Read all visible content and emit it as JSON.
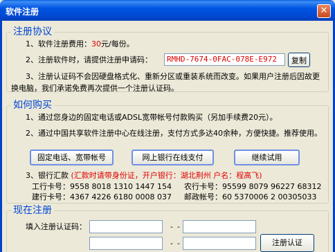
{
  "window": {
    "title": "软件注册",
    "close": "✕"
  },
  "agreement": {
    "legend": "注册协议",
    "fee_pre": "1、软件注册费用：",
    "fee_value": "30",
    "fee_post": "元/每份。",
    "code_label": "2、注册软件时，请提供注册申请码：",
    "code_value": "RMHD-7674-0FAC-078E-E972",
    "copy_button": "复制",
    "item3": "3、注册认证码不会因硬盘格式化、重新分区或重装系统而改变。如果用户注册后因故更换电脑，我们承诺免费再次提供一个注册认证码。"
  },
  "purchase": {
    "legend": "如何购买",
    "item1": "1、通过您身边的固定电话或ADSL宽带帐号付款购买（另加手续费20元）。",
    "item2": "2、通过中国共享软件注册中心在线注册，支付方式多达40余种，方便快捷。推荐使用。",
    "btn_phone": "固定电话、宽带帐号",
    "btn_online": "网上银行在线支付",
    "btn_trial": "继续试用",
    "bank_label": "3、银行汇款",
    "bank_note": "(汇款时请带身份证，开户银行：湖北荆州  户名：程高飞)",
    "accounts": [
      {
        "name": "工行卡号：",
        "number": "9558 8018 1310 1447 154"
      },
      {
        "name": "农行卡号：",
        "number": "95599 8079 96227 68312"
      },
      {
        "name": "建行卡号：",
        "number": "4367 4226 6180 0008 037"
      },
      {
        "name": "邮政帐号：",
        "number": "60 5370006 2 00305033"
      }
    ]
  },
  "register": {
    "legend": "现在注册",
    "input_label": "填入注册认证码：",
    "dash": "-",
    "register_button": "注册认证"
  }
}
